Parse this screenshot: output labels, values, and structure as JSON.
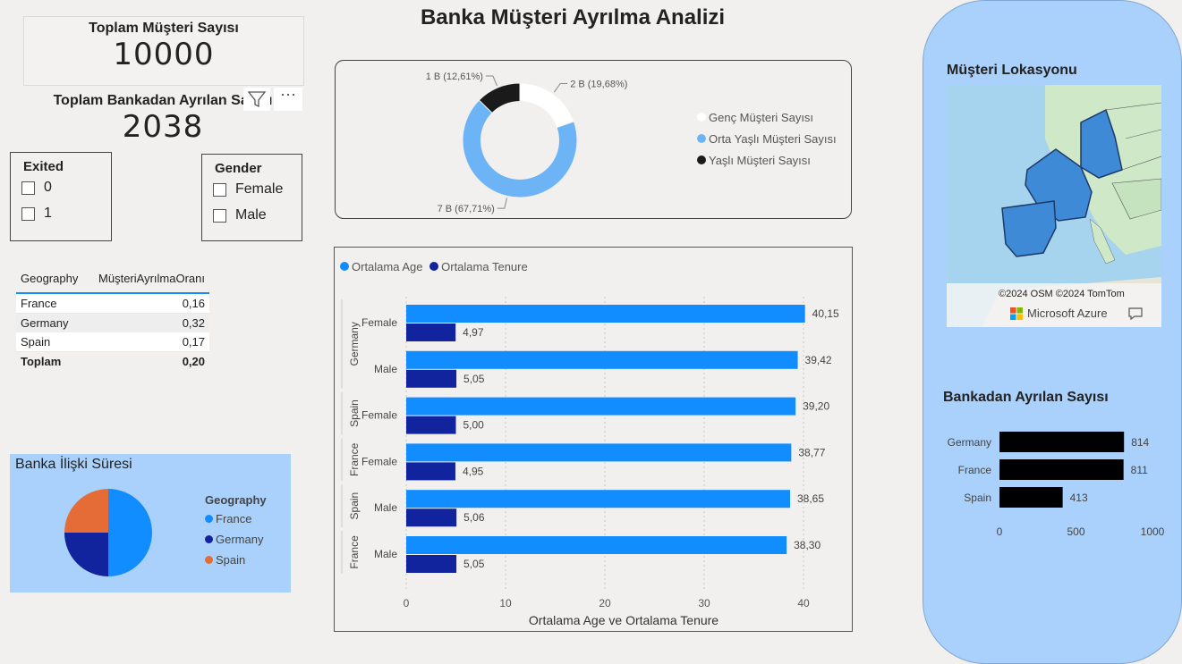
{
  "title": "Banka Müşteri Ayrılma Analizi",
  "kpi_customers": {
    "label": "Toplam Müşteri Sayısı",
    "value": "10000"
  },
  "kpi_exited": {
    "label": "Toplam Bankadan Ayrılan Sayısı",
    "value": "2038"
  },
  "slicer_exited": {
    "title": "Exited",
    "options": [
      "0",
      "1"
    ]
  },
  "slicer_gender": {
    "title": "Gender",
    "options": [
      "Female",
      "Male"
    ]
  },
  "geo_table": {
    "headers": [
      "Geography",
      "MüşteriAyrılmaOranı"
    ],
    "rows": [
      [
        "France",
        "0,16"
      ],
      [
        "Germany",
        "0,32"
      ],
      [
        "Spain",
        "0,17"
      ]
    ],
    "total": [
      "Toplam",
      "0,20"
    ]
  },
  "pie_tenure": {
    "title": "Banka İlişki Süresi",
    "legend_title": "Geography",
    "legend": [
      "France",
      "Germany",
      "Spain"
    ],
    "colors": [
      "#118dff",
      "#12239e",
      "#e66c37"
    ],
    "values": [
      50,
      25,
      25
    ]
  },
  "donut_age": {
    "legend": [
      "Genç Müşteri Sayısı",
      "Orta Yaşlı Müşteri Sayısı",
      "Yaşlı Müşteri Sayısı"
    ],
    "colors": [
      "#ffffff",
      "#6cb4f5",
      "#1a1a1a"
    ],
    "labels": [
      "2 B (19,68%)",
      "7 B (67,71%)",
      "1 B (12,61%)"
    ],
    "values": [
      19.68,
      67.71,
      12.61
    ]
  },
  "bar_chart": {
    "legend": [
      "Ortalama Age",
      "Ortalama Tenure"
    ],
    "colors": [
      "#118dff",
      "#12239e"
    ],
    "xlabel": "Ortalama Age ve Ortalama Tenure",
    "x_ticks": [
      "0",
      "10",
      "20",
      "30",
      "40"
    ],
    "groups": [
      {
        "country": "Germany",
        "gender": "Female",
        "age": "40,15",
        "tenure": "4,97"
      },
      {
        "country": "Germany",
        "gender": "Male",
        "age": "39,42",
        "tenure": "5,05"
      },
      {
        "country": "Spain",
        "gender": "Female",
        "age": "39,20",
        "tenure": "5,00"
      },
      {
        "country": "France",
        "gender": "Female",
        "age": "38,77",
        "tenure": "4,95"
      },
      {
        "country": "Spain",
        "gender": "Male",
        "age": "38,65",
        "tenure": "5,06"
      },
      {
        "country": "France",
        "gender": "Male",
        "age": "38,30",
        "tenure": "5,05"
      }
    ]
  },
  "chart_data": {
    "type": "bar",
    "categories": [
      "Germany Female",
      "Germany Male",
      "Spain Female",
      "France Female",
      "Spain Male",
      "France Male"
    ],
    "series": [
      {
        "name": "Ortalama Age",
        "values": [
          40.15,
          39.42,
          39.2,
          38.77,
          38.65,
          38.3
        ]
      },
      {
        "name": "Ortalama Tenure",
        "values": [
          4.97,
          5.05,
          5.0,
          4.95,
          5.06,
          5.05
        ]
      }
    ],
    "xlabel": "Ortalama Age ve Ortalama Tenure",
    "xlim": [
      0,
      45
    ]
  },
  "map": {
    "title": "Müşteri Lokasyonu",
    "attribution": "©2024 OSM  ©2024 TomTom",
    "brand": "Microsoft Azure"
  },
  "exit_bar": {
    "title": "Bankadan Ayrılan Sayısı",
    "categories": [
      "Germany",
      "France",
      "Spain"
    ],
    "values": [
      814,
      811,
      413
    ],
    "labels": [
      "814",
      "811",
      "413"
    ],
    "ticks": [
      "0",
      "500",
      "1000"
    ],
    "xlim": [
      0,
      1000
    ]
  }
}
